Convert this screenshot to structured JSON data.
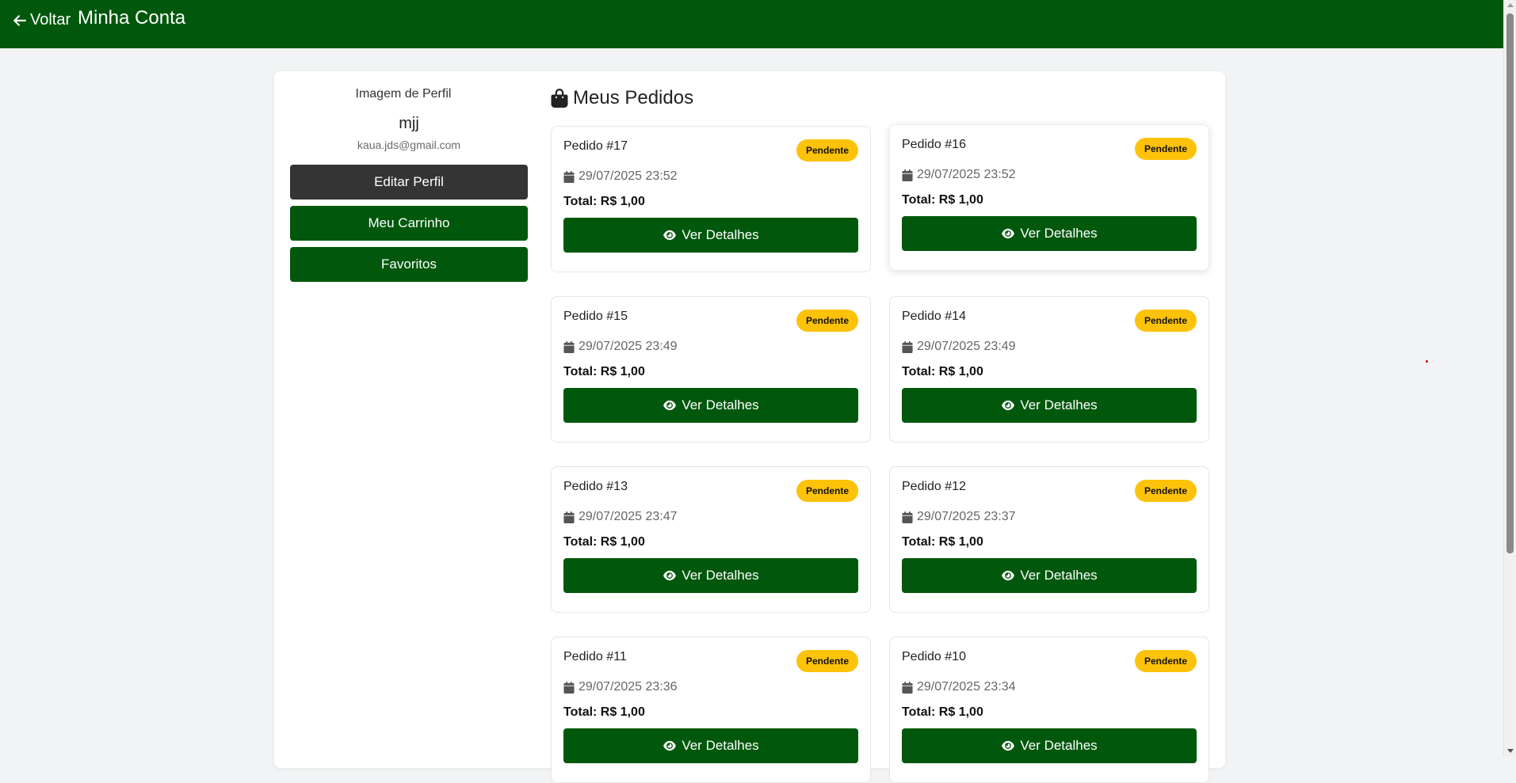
{
  "header": {
    "back_label": "Voltar",
    "title": "Minha Conta"
  },
  "profile": {
    "image_alt": "Imagem de Perfil",
    "name": "mjj",
    "email": "kaua.jds@gmail.com",
    "edit_label": "Editar Perfil",
    "cart_label": "Meu Carrinho",
    "favorites_label": "Favoritos"
  },
  "orders_section": {
    "title": "Meus Pedidos",
    "total_prefix": "Total: ",
    "details_label": "Ver Detalhes"
  },
  "orders": [
    {
      "title": "Pedido #17",
      "status": "Pendente",
      "date": "29/07/2025 23:52",
      "total": "Total: R$ 1,00"
    },
    {
      "title": "Pedido #16",
      "status": "Pendente",
      "date": "29/07/2025 23:52",
      "total": "Total: R$ 1,00"
    },
    {
      "title": "Pedido #15",
      "status": "Pendente",
      "date": "29/07/2025 23:49",
      "total": "Total: R$ 1,00"
    },
    {
      "title": "Pedido #14",
      "status": "Pendente",
      "date": "29/07/2025 23:49",
      "total": "Total: R$ 1,00"
    },
    {
      "title": "Pedido #13",
      "status": "Pendente",
      "date": "29/07/2025 23:47",
      "total": "Total: R$ 1,00"
    },
    {
      "title": "Pedido #12",
      "status": "Pendente",
      "date": "29/07/2025 23:37",
      "total": "Total: R$ 1,00"
    },
    {
      "title": "Pedido #11",
      "status": "Pendente",
      "date": "29/07/2025 23:36",
      "total": "Total: R$ 1,00"
    },
    {
      "title": "Pedido #10",
      "status": "Pendente",
      "date": "29/07/2025 23:34",
      "total": "Total: R$ 1,00"
    }
  ],
  "colors": {
    "brand_green": "#01580c",
    "badge_yellow": "#fdc20a",
    "dark_button": "#343434"
  }
}
